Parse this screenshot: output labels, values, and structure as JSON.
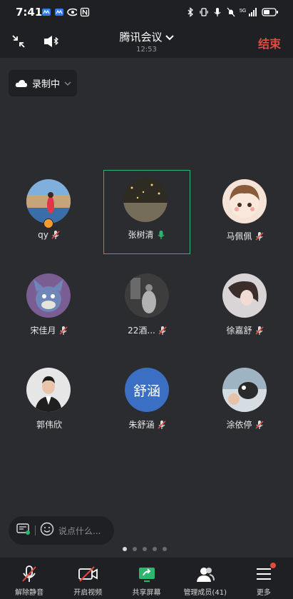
{
  "status_bar": {
    "time": "7:41",
    "icons_left": [
      "meeting-app-icon",
      "meeting-app-icon",
      "eye-icon",
      "nfc-icon"
    ],
    "icons_right": [
      "bluetooth-icon",
      "vibrate-icon",
      "mic-icon",
      "mute-icon",
      "signal-icon",
      "battery-icon"
    ],
    "network": "5G"
  },
  "header": {
    "title": "腾讯会议",
    "elapsed": "12:53",
    "end_label": "结束"
  },
  "record_badge": {
    "label": "录制中"
  },
  "participants": [
    {
      "name": "qy",
      "mic": "muted",
      "host": true,
      "avatar_color": "#5a86b8"
    },
    {
      "name": "张树清",
      "mic": "speaking",
      "active": true,
      "avatar_color": "#3c3a30"
    },
    {
      "name": "马佩佩",
      "mic": "muted",
      "avatar_color": "#f0d2c3"
    },
    {
      "name": "宋佳月",
      "mic": "muted",
      "avatar_color": "#6b6fa8"
    },
    {
      "name": "22酒...",
      "mic": "muted",
      "avatar_color": "#4a4a4a"
    },
    {
      "name": "徐嘉舒",
      "mic": "muted",
      "avatar_color": "#cfc8cc"
    },
    {
      "name": "郭伟欣",
      "mic": "none",
      "avatar_color": "#d9d9d9"
    },
    {
      "name": "朱舒涵",
      "mic": "muted",
      "avatar_text": "舒涵",
      "avatar_color": "#3a6fc3"
    },
    {
      "name": "涂依停",
      "mic": "muted",
      "avatar_color": "#8aa4b4"
    }
  ],
  "chat": {
    "placeholder": "说点什么..."
  },
  "pagination": {
    "pages": 5,
    "current": 1
  },
  "toolbar": {
    "unmute": "解除静音",
    "video": "开启视频",
    "share": "共享屏幕",
    "members": "管理成员(41)",
    "more": "更多"
  },
  "colors": {
    "background": "#2b2c2f",
    "bar": "#1f2023",
    "accent_green": "#2fb66e",
    "danger_red": "#e04a3f"
  }
}
